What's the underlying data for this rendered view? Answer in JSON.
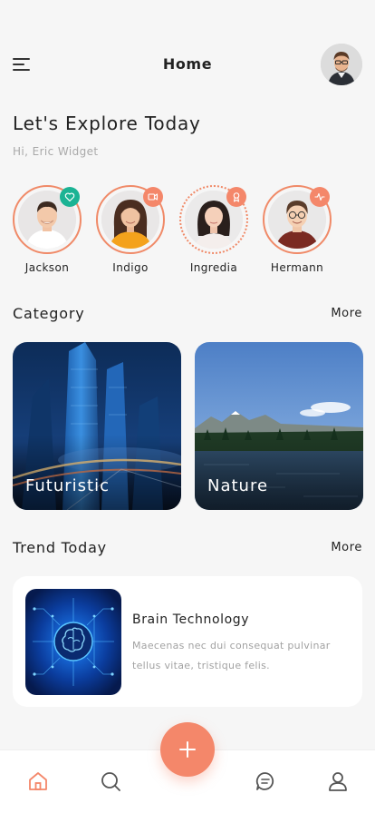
{
  "header": {
    "title": "Home",
    "menu_icon": "hamburger-menu-icon",
    "avatar_icon": "user-avatar"
  },
  "hero": {
    "headline": "Let's Explore Today",
    "greeting": "Hi, Eric Widget"
  },
  "stories": [
    {
      "name": "Jackson",
      "badge_icon": "heart-icon",
      "badge_color": "#1bb394"
    },
    {
      "name": "Indigo",
      "badge_icon": "video-camera-icon",
      "badge_color": "#f4876a"
    },
    {
      "name": "Ingredia",
      "badge_icon": "award-icon",
      "badge_color": "#f4876a"
    },
    {
      "name": "Hermann",
      "badge_icon": "activity-icon",
      "badge_color": "#f4876a"
    }
  ],
  "category": {
    "title": "Category",
    "more_label": "More",
    "items": [
      {
        "label": "Futuristic"
      },
      {
        "label": "Nature"
      }
    ]
  },
  "trend": {
    "title": "Trend Today",
    "more_label": "More",
    "card": {
      "title": "Brain Technology",
      "description": "Maecenas nec dui consequat pulvinar tellus vitae, tristique felis."
    }
  },
  "nav": {
    "items": [
      {
        "icon": "home-icon",
        "active": true
      },
      {
        "icon": "search-icon",
        "active": false
      },
      {
        "icon": "chat-icon",
        "active": false
      },
      {
        "icon": "profile-icon",
        "active": false
      }
    ],
    "fab_icon": "plus-icon"
  },
  "colors": {
    "accent": "#f4876a",
    "background": "#f6f6f6",
    "green_badge": "#1bb394",
    "muted_text": "#a9a9a9"
  }
}
